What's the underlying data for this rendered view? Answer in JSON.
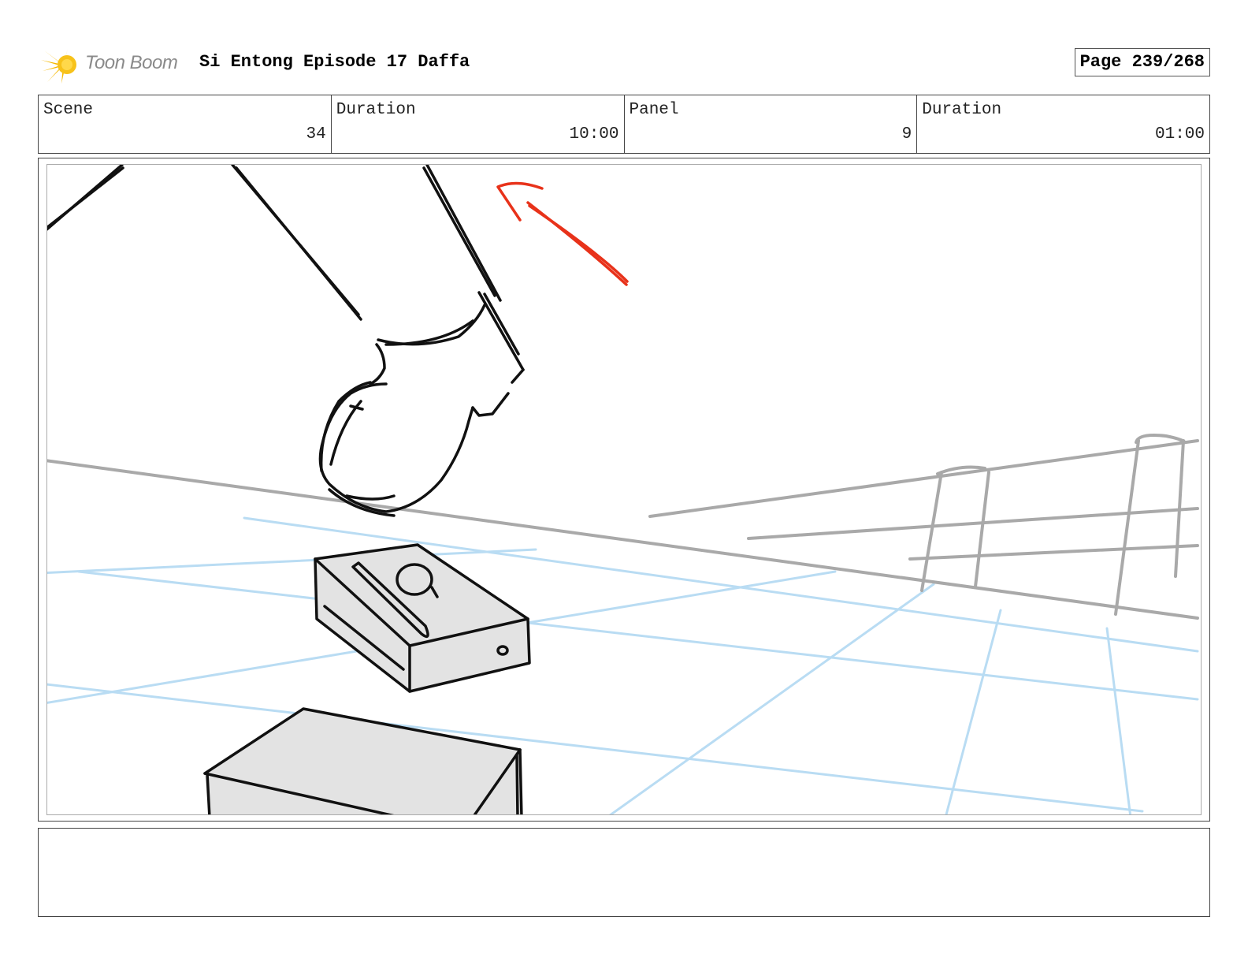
{
  "header": {
    "logo_text": "Toon Boom",
    "title": "Si Entong Episode 17 Daffa",
    "page": "Page 239/268"
  },
  "info": {
    "scene_label": "Scene",
    "scene_value": "34",
    "duration_label": "Duration",
    "duration_value": "10:00",
    "panel_label": "Panel",
    "panel_value": "9",
    "panel_duration_label": "Duration",
    "panel_duration_value": "01:00"
  },
  "notes": {
    "text": ""
  },
  "colors": {
    "accent_arrow": "#e8321a",
    "floor_lines": "#b9dcf3",
    "background_lines": "#a9a9a9",
    "box_fill": "#e3e3e3",
    "logo_star": "#f5b800"
  },
  "icons": {
    "logo": "toon-boom-star-icon"
  }
}
